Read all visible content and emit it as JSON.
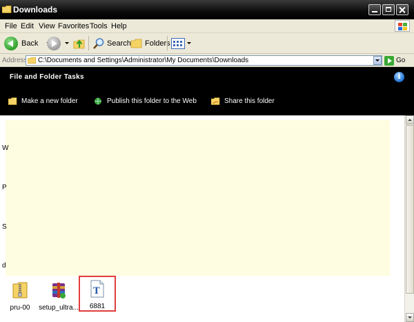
{
  "window": {
    "title": "Downloads"
  },
  "menu": [
    "File",
    "Edit",
    "View",
    "Favorites",
    "Tools",
    "Help"
  ],
  "toolbar": {
    "back_label": "Back",
    "search_label": "Search",
    "folders_label": "Folders"
  },
  "address": {
    "label": "Address",
    "path": "C:\\Documents and Settings\\Administrator\\My Documents\\Downloads",
    "go_label": "Go"
  },
  "tasks": {
    "heading": "File and Folder Tasks",
    "items": [
      "Make a new folder",
      "Publish this folder to the Web",
      "Share this folder"
    ]
  },
  "side_chars": [
    "W",
    "P",
    "S",
    "d"
  ],
  "files": [
    {
      "name": "pru-00",
      "icon": "zip-folder-icon"
    },
    {
      "name": "setup_ultra...",
      "icon": "winrar-installer-icon"
    },
    {
      "name": "6881",
      "icon": "text-document-icon",
      "selected": true
    }
  ],
  "colors": {
    "titlebar": "#000000",
    "taskpane": "#000000",
    "content_highlight": "#fffde1",
    "selection_border": "#e23b3b"
  }
}
